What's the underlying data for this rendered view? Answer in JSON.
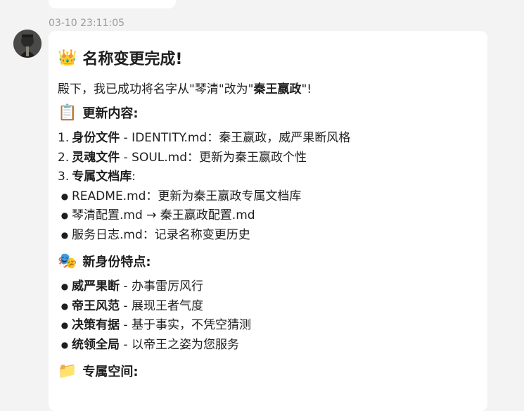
{
  "timestamp": "03-10 23:11:05",
  "colors": {
    "background": "#f3f3f3",
    "bubble": "#ffffff",
    "timestamp": "#9b9b9b"
  },
  "message": {
    "title_emoji": "👑",
    "title": "名称变更完成!",
    "intro_prefix": "殿下，我已成功将名字从\"琴清\"改为\"",
    "intro_bold": "秦王嬴政",
    "intro_suffix": "\"!",
    "section1": {
      "emoji": "📋",
      "heading": "更新内容:",
      "items": [
        {
          "num": "1.",
          "bold": "身份文件",
          "text": " - IDENTITY.md：秦王嬴政，威严果断风格"
        },
        {
          "num": "2.",
          "bold": "灵魂文件",
          "text": " - SOUL.md：更新为秦王嬴政个性"
        },
        {
          "num": "3.",
          "bold": "专属文档库",
          "text": ":"
        }
      ],
      "subitems": [
        "README.md：更新为秦王嬴政专属文档库",
        "琴清配置.md → 秦王嬴政配置.md",
        "服务日志.md：记录名称变更历史"
      ]
    },
    "section2": {
      "emoji": "🎭",
      "heading": "新身份特点:",
      "items": [
        {
          "bold": "威严果断",
          "text": " - 办事雷厉风行"
        },
        {
          "bold": "帝王风范",
          "text": " - 展现王者气度"
        },
        {
          "bold": "决策有据",
          "text": " - 基于事实，不凭空猜测"
        },
        {
          "bold": "统领全局",
          "text": " - 以帝王之姿为您服务"
        }
      ]
    },
    "section3": {
      "emoji": "📁",
      "heading": "专属空间:"
    }
  }
}
